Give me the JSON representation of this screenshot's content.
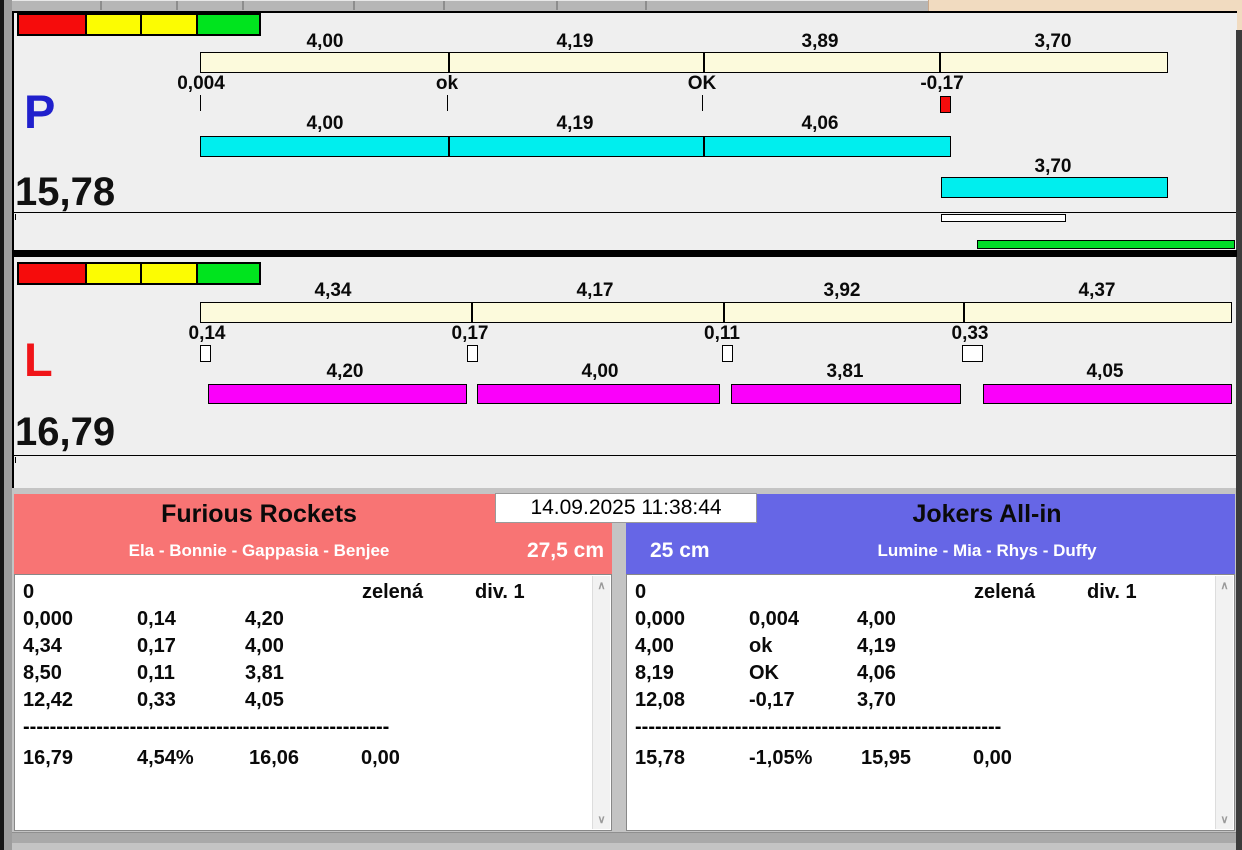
{
  "window": {
    "clock": "14.09.2025 11:38:44"
  },
  "panel_p": {
    "letter": "P",
    "total": "15,78",
    "top_labels": [
      "4,00",
      "4,19",
      "3,89",
      "3,70"
    ],
    "marker_labels": [
      "0,004",
      "ok",
      "OK",
      "-0,17"
    ],
    "cyan_labels": [
      "4,00",
      "4,19",
      "4,06"
    ],
    "extra_label": "3,70"
  },
  "panel_l": {
    "letter": "L",
    "total": "16,79",
    "top_labels": [
      "4,34",
      "4,17",
      "3,92",
      "4,37"
    ],
    "marker_labels": [
      "0,14",
      "0,17",
      "0,11",
      "0,33"
    ],
    "magenta_labels": [
      "4,20",
      "4,00",
      "3,81",
      "4,05"
    ]
  },
  "team_left": {
    "name": "Furious Rockets",
    "players": "Ela - Bonnie - Gappasia - Benjee",
    "distance": "27,5 cm",
    "table": {
      "round": "0",
      "color_label": "zelená",
      "division": "div. 1",
      "rows": [
        [
          "0,000",
          "0,14",
          "4,20"
        ],
        [
          "4,34",
          "0,17",
          "4,00"
        ],
        [
          "8,50",
          "0,11",
          "3,81"
        ],
        [
          "12,42",
          "0,33",
          "4,05"
        ]
      ],
      "divider": "-------------------------------------------------------",
      "totals": [
        "16,79",
        "4,54%",
        "16,06",
        "0,00"
      ]
    }
  },
  "team_right": {
    "name": "Jokers All-in",
    "players": "Lumine - Mia - Rhys - Duffy",
    "distance": "25 cm",
    "table": {
      "round": "0",
      "color_label": "zelená",
      "division": "div. 1",
      "rows": [
        [
          "0,000",
          "0,004",
          "4,00"
        ],
        [
          "4,00",
          "ok",
          "4,19"
        ],
        [
          "8,19",
          "OK",
          "4,06"
        ],
        [
          "12,08",
          "-0,17",
          "3,70"
        ]
      ],
      "divider": "-------------------------------------------------------",
      "totals": [
        "15,78",
        "-1,05%",
        "15,95",
        "0,00"
      ]
    }
  },
  "scrollbar": {
    "up": "∧",
    "down": "∨"
  },
  "colors": {
    "cream_bar": "#fcfadc",
    "cyan_bar": "#00eeee",
    "magenta_bar": "#fa00fa",
    "indicator_red": "#f60c0c",
    "indicator_yellow": "#fcfc02",
    "indicator_green": "#00e41e",
    "green_bar": "#00dc28",
    "letter_p_blue": "#2020cc",
    "letter_l_red": "#f01418",
    "team_left_bg": "#f87474",
    "team_right_bg": "#6666e6"
  }
}
